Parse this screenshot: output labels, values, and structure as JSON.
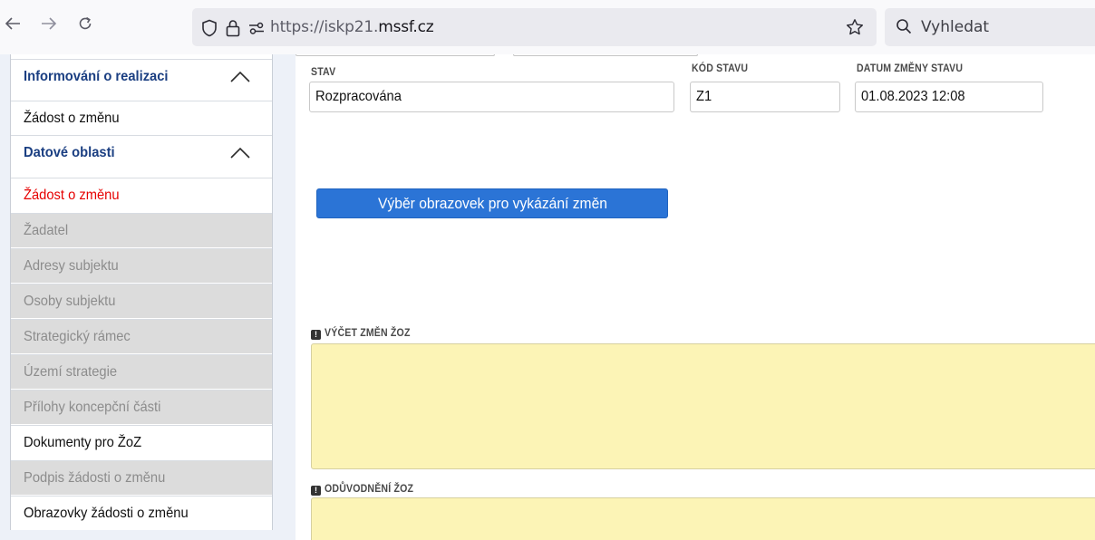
{
  "browser": {
    "url_scheme": "https://",
    "url_subdomain": "iskp21.",
    "url_host": "mssf.cz",
    "search_placeholder": "Vyhledat",
    "icons": [
      "back-icon",
      "forward-icon",
      "reload-icon",
      "shield-icon",
      "lock-icon",
      "permissions-icon",
      "bookmark-star-icon",
      "search-icon"
    ]
  },
  "sidebar": {
    "items": [
      {
        "label": "Informování o realizaci",
        "kind": "group"
      },
      {
        "label": "Žádost o změnu",
        "kind": "plain"
      },
      {
        "label": "Datové oblasti",
        "kind": "group"
      },
      {
        "label": "Žádost o změnu",
        "kind": "active"
      },
      {
        "label": "Žadatel",
        "kind": "disabled"
      },
      {
        "label": "Adresy subjektu",
        "kind": "disabled"
      },
      {
        "label": "Osoby subjektu",
        "kind": "disabled"
      },
      {
        "label": "Strategický rámec",
        "kind": "disabled"
      },
      {
        "label": "Území strategie",
        "kind": "disabled"
      },
      {
        "label": "Přílohy koncepční části",
        "kind": "disabled"
      },
      {
        "label": "Dokumenty pro ŽoZ",
        "kind": "plain"
      },
      {
        "label": "Podpis žádosti o změnu",
        "kind": "disabled"
      },
      {
        "label": "Obrazovky žádosti o změnu",
        "kind": "plain"
      }
    ]
  },
  "form": {
    "stav_label": "STAV",
    "stav_value": "Rozpracována",
    "kod_label": "KÓD STAVU",
    "kod_value": "Z1",
    "datum_label": "DATUM ZMĚNY STAVU",
    "datum_value": "01.08.2023 12:08",
    "action_button": "Výběr obrazovek pro vykázání změn",
    "vycet_label": "VÝČET ZMĚN ŽOZ",
    "vycet_value": "",
    "oduvodneni_label": "ODŮVODNĚNÍ ŽOZ",
    "oduvodneni_value": ""
  },
  "colors": {
    "sidebar_group": "#1b3f82",
    "sidebar_active": "#e60000",
    "sidebar_disabled_bg": "#dcdcdc",
    "button_blue": "#2b74d6",
    "required_field_bg": "#fcf4b6"
  }
}
